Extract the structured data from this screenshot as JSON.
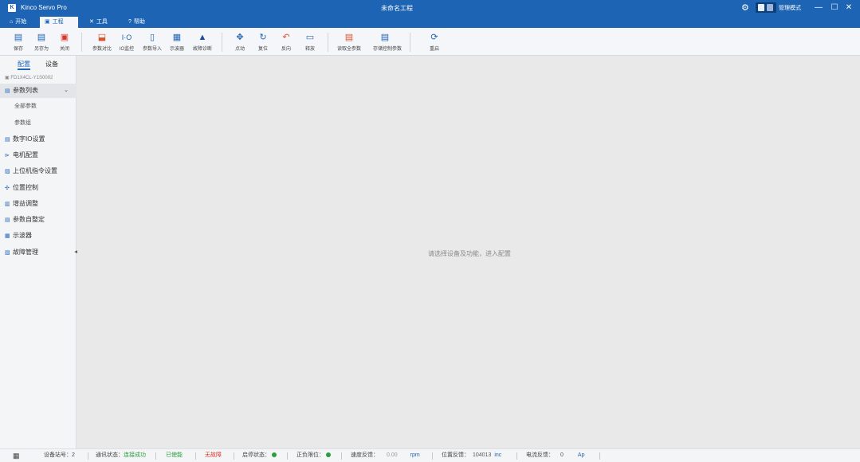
{
  "titlebar": {
    "logo": "K",
    "app_name": "Kinco Servo Pro",
    "document": "未命名工程",
    "username": "管理模式",
    "minimize": "—",
    "maximize": "☐",
    "close": "✕"
  },
  "menu": {
    "tabs": [
      {
        "icon": "⌂",
        "label": "开始"
      },
      {
        "icon": "▣",
        "label": "工程"
      },
      {
        "icon": "✕",
        "label": "工具"
      },
      {
        "icon": "?",
        "label": "帮助"
      }
    ]
  },
  "toolbar": {
    "save": "保存",
    "save_as": "另存为",
    "close": "关闭",
    "param_compare": "参数对比",
    "io_monitor": "IO监控",
    "param_import": "参数导入",
    "oscilloscope": "示波器",
    "fault_diag": "故障诊断",
    "jog": "点动",
    "reset": "复位",
    "reverse": "反向",
    "release": "释放",
    "read_params": "读取全参数",
    "store_params": "存储控制参数",
    "restart": "重启"
  },
  "sidebar": {
    "tab_config": "配置",
    "tab_device": "设备",
    "device_line": "FD1X4CL-Y1S0002",
    "param_list": "参数列表",
    "all_params": "全部参数",
    "param_group": "参数组",
    "items": [
      "数字IO设置",
      "电机配置",
      "上位机指令设置",
      "位置控制",
      "增益调整",
      "参数自整定",
      "示波器",
      "故障管理"
    ]
  },
  "main": {
    "hint": "请选择设备及功能，进入配置"
  },
  "statusbar": {
    "device_no_label": "设备站号：",
    "device_no_value": "2",
    "conn_label": "通讯状态：",
    "conn_value": "连接成功",
    "enabled": "已使能",
    "fault": "无故障",
    "sys_label": "启停状态：",
    "pos_label": "正负限位：",
    "speed_label": "速度反馈：",
    "speed_value": "0.00",
    "speed_unit": "rpm",
    "pos_fb_label": "位置反馈：",
    "pos_fb_value": "104013",
    "pos_fb_unit": "inc",
    "current_label": "电流反馈：",
    "current_value": "0",
    "current_unit": "Ap",
    "colors": {
      "ok": "#2a9d3e",
      "fault": "#d9352b",
      "accent": "#1e64b4"
    }
  }
}
